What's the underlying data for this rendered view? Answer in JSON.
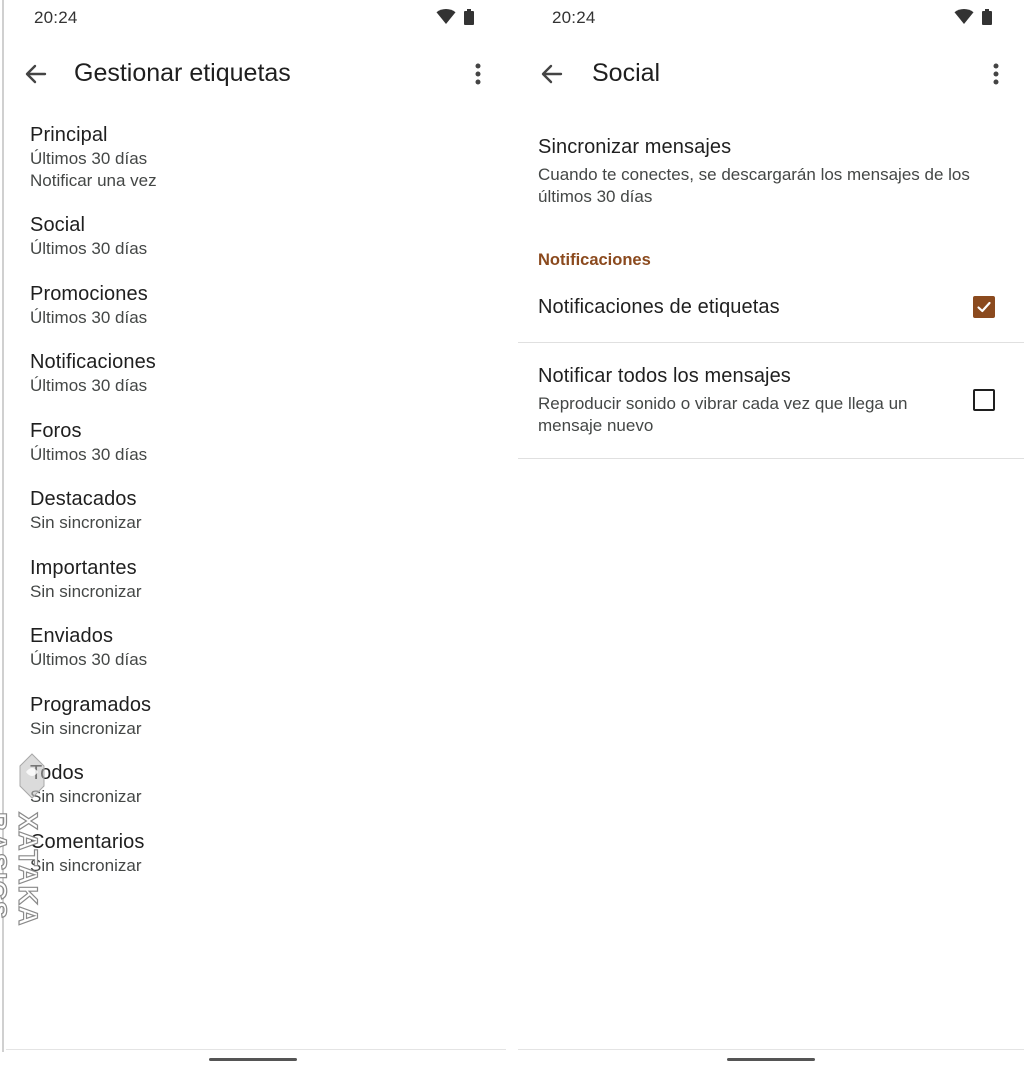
{
  "left": {
    "status": {
      "time": "20:24"
    },
    "app_bar": {
      "title": "Gestionar etiquetas"
    },
    "labels": [
      {
        "name": "Principal",
        "detail": "Últimos 30 días",
        "extra": "Notificar una vez"
      },
      {
        "name": "Social",
        "detail": "Últimos 30 días"
      },
      {
        "name": "Promociones",
        "detail": "Últimos 30 días"
      },
      {
        "name": "Notificaciones",
        "detail": "Últimos 30 días"
      },
      {
        "name": "Foros",
        "detail": "Últimos 30 días"
      },
      {
        "name": "Destacados",
        "detail": "Sin sincronizar"
      },
      {
        "name": "Importantes",
        "detail": "Sin sincronizar"
      },
      {
        "name": "Enviados",
        "detail": "Últimos 30 días"
      },
      {
        "name": "Programados",
        "detail": "Sin sincronizar"
      },
      {
        "name": "Todos",
        "detail": "Sin sincronizar"
      },
      {
        "name": "Comentarios",
        "detail": "Sin sincronizar"
      }
    ],
    "watermark": "XATAKA BASICS"
  },
  "right": {
    "status": {
      "time": "20:24"
    },
    "app_bar": {
      "title": "Social"
    },
    "sync": {
      "title": "Sincronizar mensajes",
      "desc_line1": "Cuando te conectes, se descargarán los mensajes de los",
      "desc_line2": "últimos 30 días"
    },
    "section_header": "Notificaciones",
    "label_notifications": {
      "title": "Notificaciones de etiquetas",
      "checked": true
    },
    "notify_all": {
      "title": "Notificar todos los mensajes",
      "desc_line1": "Reproducir sonido o vibrar cada vez que llega un",
      "desc_line2": "mensaje nuevo",
      "checked": false
    }
  },
  "colors": {
    "accent": "#8b4a1e",
    "text": "#1f1f1f",
    "secondary_text": "#444746"
  },
  "icons": [
    "wifi-icon",
    "battery-icon",
    "back-arrow-icon",
    "more-vert-icon",
    "check-icon"
  ]
}
